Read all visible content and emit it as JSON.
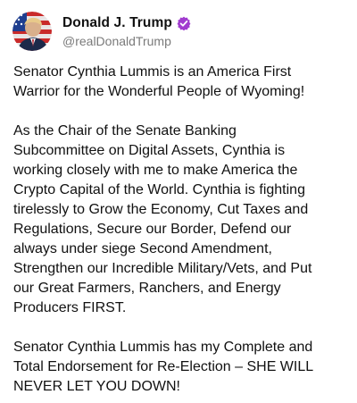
{
  "author": {
    "display_name": "Donald J. Trump",
    "handle": "@realDonaldTrump",
    "verified_icon": "verified-badge-icon",
    "avatar_icon": "profile-avatar"
  },
  "colors": {
    "verified_badge": "#a13ccf",
    "handle_text": "#7a7a7a",
    "body_text": "#111111"
  },
  "post": {
    "paragraphs": [
      {
        "lines": [
          "Senator Cynthia Lummis is an America First",
          "Warrior for the Wonderful People of Wyoming!"
        ]
      },
      {
        "lines": [
          "As the Chair of the Senate Banking",
          "Subcommittee on Digital Assets, Cynthia is",
          "working closely with me to make America the",
          "Crypto Capital of the World. Cynthia is fighting",
          "tirelessly to Grow the Economy, Cut Taxes and",
          "Regulations, Secure our Border, Defend our",
          "always under siege Second Amendment,",
          "Strengthen our Incredible Military/Vets, and Put",
          "our Great Farmers, Ranchers, and Energy",
          "Producers FIRST."
        ]
      },
      {
        "lines": [
          "Senator Cynthia Lummis has my Complete and",
          "Total Endorsement for Re-Election – SHE WILL",
          "NEVER LET YOU DOWN!"
        ]
      }
    ]
  }
}
